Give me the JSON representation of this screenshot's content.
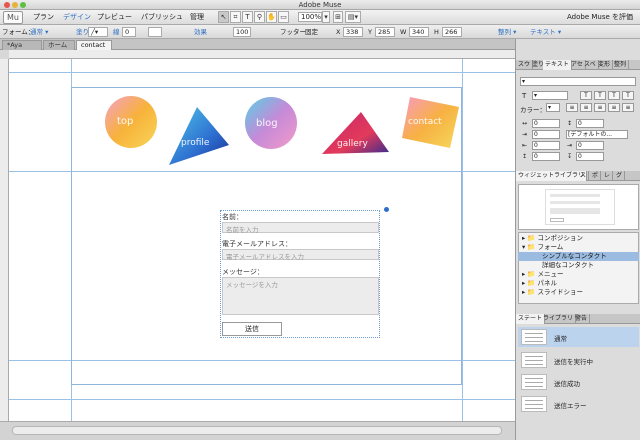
{
  "window": {
    "title": "Adobe Muse"
  },
  "menubar": {
    "logo": "Mu",
    "items": [
      "プラン",
      "デザイン",
      "プレビュー",
      "パブリッシュ",
      "管理"
    ],
    "active_index": 1,
    "zoom": "100%",
    "trial": "Adobe Muse を評価"
  },
  "controlbar": {
    "form_label": "フォーム：",
    "form_value": "通常 ▾",
    "fill_label": "塗り",
    "stroke_label": "線",
    "stroke_value": "0",
    "effect_label": "効果",
    "opacity": "100",
    "footer_label": "フッター",
    "fixed_label": "固定",
    "x_label": "X",
    "x_value": "338",
    "y_label": "Y",
    "y_value": "285",
    "w_label": "W",
    "w_value": "340",
    "h_label": "H",
    "h_value": "266",
    "align_label": "整列 ▾",
    "text_label": "テキスト ▾"
  },
  "tabs": [
    "*Aya",
    "ホーム",
    "contact"
  ],
  "active_tab": 2,
  "nav": [
    "top",
    "profile",
    "blog",
    "gallery",
    "contact"
  ],
  "form": {
    "name_label": "名前：",
    "name_placeholder": "名前を入力",
    "email_label": "電子メールアドレス：",
    "email_placeholder": "電子メールアドレスを入力",
    "message_label": "メッセージ：",
    "message_placeholder": "メッセージを入力",
    "submit": "送信"
  },
  "panel_text": {
    "tabs": [
      "スウ",
      "塗り",
      "テキスト",
      "アセ",
      "スペ",
      "変形",
      "整列"
    ],
    "active": 2,
    "color_label": "カラー：",
    "placeholder_font": "[デフォルトの...",
    "values": [
      "0",
      "0",
      "0",
      "0",
      "0",
      "0",
      "0"
    ]
  },
  "panel_widgets": {
    "tabs": [
      "ウィジェットライブラリ",
      "ス",
      "ポ",
      "レ",
      "グ"
    ],
    "tree": [
      {
        "label": "コンポジション",
        "indent": 0,
        "open": false
      },
      {
        "label": "フォーム",
        "indent": 0,
        "open": true
      },
      {
        "label": "シンプルなコンタクト",
        "indent": 1,
        "selected": true
      },
      {
        "label": "詳細なコンタクト",
        "indent": 1
      },
      {
        "label": "メニュー",
        "indent": 0,
        "open": false
      },
      {
        "label": "パネル",
        "indent": 0,
        "open": false
      },
      {
        "label": "スライドショー",
        "indent": 0,
        "open": false
      }
    ]
  },
  "panel_states": {
    "tabs": [
      "ステート",
      "ライブラリ",
      "警告"
    ],
    "states": [
      "通常",
      "送信を実行中",
      "送信成功",
      "送信エラー"
    ],
    "selected": 0
  }
}
